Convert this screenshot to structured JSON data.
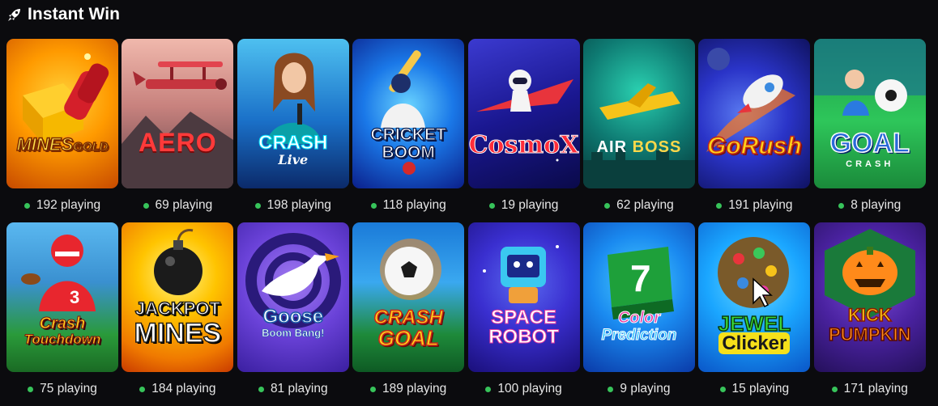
{
  "section": {
    "title": "Instant Win",
    "icon": "rocket-icon"
  },
  "status_color": "#37c35a",
  "games": [
    {
      "id": "mines-gold",
      "logo_main": "MINES",
      "logo_sub": "GOLD",
      "players": "192 playing",
      "bg": [
        "#ffb300",
        "#d45400"
      ]
    },
    {
      "id": "aero",
      "logo_main": "AERO",
      "logo_sub": "",
      "players": "69 playing",
      "bg": [
        "#e09a95",
        "#6a4a50"
      ]
    },
    {
      "id": "crash-live",
      "logo_main": "CRASH",
      "logo_sub": "Live",
      "players": "198 playing",
      "bg": [
        "#1e9fe0",
        "#0a2a6b"
      ]
    },
    {
      "id": "cricket-boom",
      "logo_main": "CRICKET",
      "logo_sub": "BOOM",
      "players": "118 playing",
      "bg": [
        "#1aa3ff",
        "#0b2b9a"
      ]
    },
    {
      "id": "cosmox",
      "logo_main": "CosmoX",
      "logo_sub": "",
      "players": "19 playing",
      "bg": [
        "#2d2aa8",
        "#0a0a4a"
      ]
    },
    {
      "id": "air-boss",
      "logo_main": "AIR",
      "logo_sub": "BOSS",
      "players": "62 playing",
      "bg": [
        "#0f8a7d",
        "#063a3d"
      ]
    },
    {
      "id": "gorush",
      "logo_main": "GoRush",
      "logo_sub": "",
      "players": "191 playing",
      "bg": [
        "#3a4dd8",
        "#141a6e"
      ]
    },
    {
      "id": "goal-crash",
      "logo_main": "GOAL",
      "logo_sub": "CRASH",
      "players": "8 playing",
      "bg": [
        "#2ec65a",
        "#0b6b2c"
      ]
    },
    {
      "id": "crash-touchdown",
      "logo_main": "Crash",
      "logo_sub": "Touchdown",
      "players": "75 playing",
      "bg": [
        "#2fa6e8",
        "#1f7a2a"
      ]
    },
    {
      "id": "jackpot-mines",
      "logo_main": "JACKPOT",
      "logo_sub": "MINES",
      "players": "184 playing",
      "bg": [
        "#ffcc00",
        "#e05a00"
      ]
    },
    {
      "id": "goose-boom-bang",
      "logo_main": "Goose",
      "logo_sub": "Boom Bang!",
      "players": "81 playing",
      "bg": [
        "#7b4de0",
        "#3a1fa0"
      ]
    },
    {
      "id": "crash-goal",
      "logo_main": "CRASH",
      "logo_sub": "GOAL",
      "players": "189 playing",
      "bg": [
        "#2aa0e8",
        "#0e5a2a"
      ]
    },
    {
      "id": "space-robot",
      "logo_main": "SPACE",
      "logo_sub": "ROBOT",
      "players": "100 playing",
      "bg": [
        "#3a2fd0",
        "#1a0f7a"
      ]
    },
    {
      "id": "color-prediction",
      "logo_main": "Color",
      "logo_sub": "Prediction",
      "players": "9 playing",
      "bg": [
        "#16a6ff",
        "#0a4aa8"
      ]
    },
    {
      "id": "jewel-clicker",
      "logo_main": "JEWEL",
      "logo_sub": "Clicker",
      "players": "15 playing",
      "bg": [
        "#1aa6ff",
        "#0a56c8"
      ]
    },
    {
      "id": "kick-pumpkin",
      "logo_main": "KICK",
      "logo_sub": "PUMPKIN",
      "players": "171 playing",
      "bg": [
        "#5b2fa8",
        "#24105a"
      ]
    }
  ]
}
